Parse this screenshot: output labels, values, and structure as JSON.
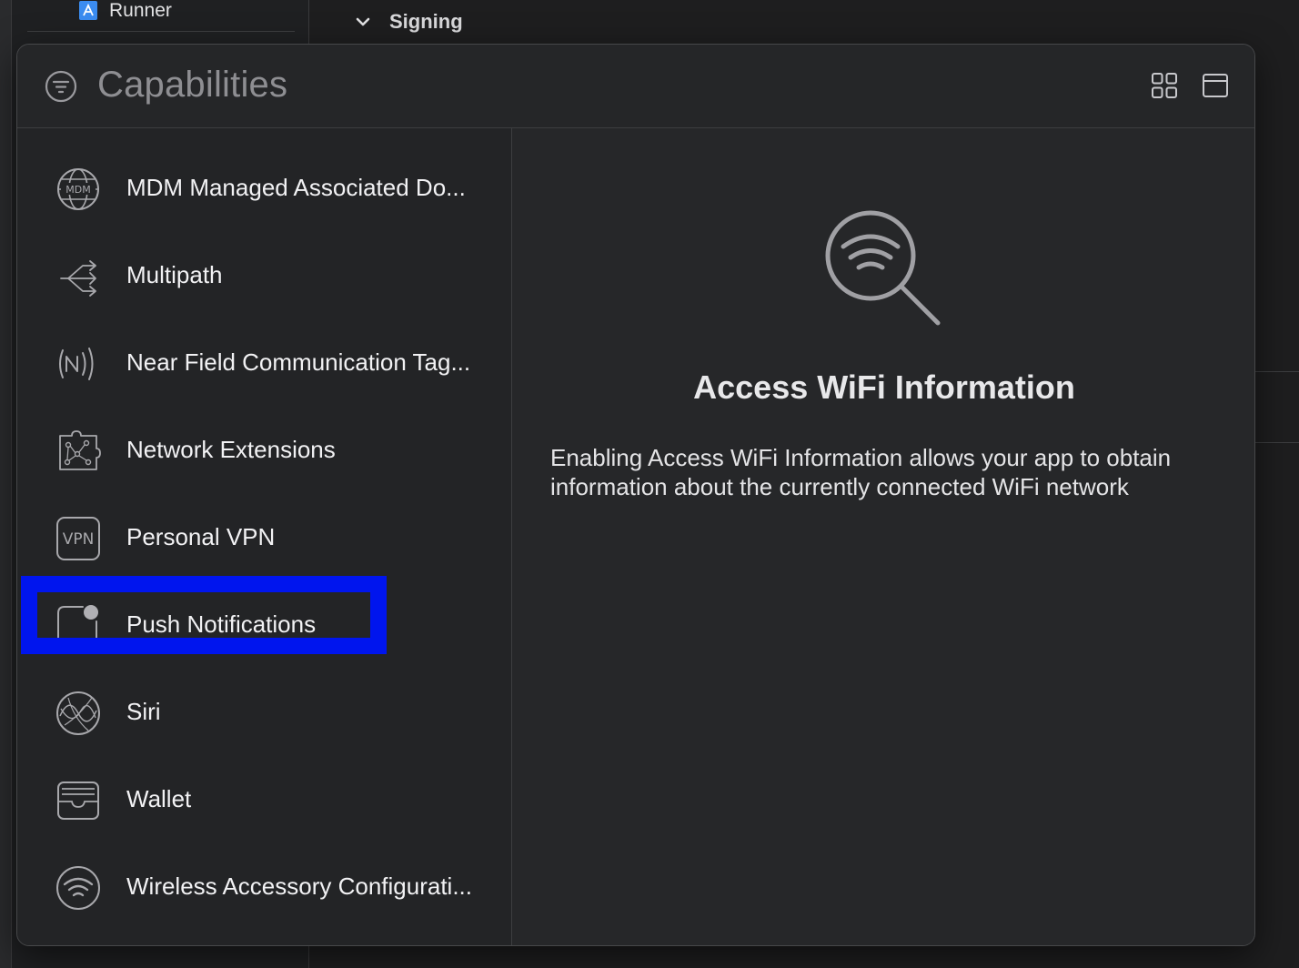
{
  "background": {
    "project_item": "Runner",
    "section_header": "Signing"
  },
  "popover": {
    "title": "Capabilities"
  },
  "capabilities": [
    {
      "label": "MDM Managed Associated Do...",
      "icon_text": "MDM"
    },
    {
      "label": "Multipath"
    },
    {
      "label": "Near Field Communication Tag..."
    },
    {
      "label": "Network Extensions"
    },
    {
      "label": "Personal VPN",
      "icon_text": "VPN"
    },
    {
      "label": "Push Notifications"
    },
    {
      "label": "Siri"
    },
    {
      "label": "Wallet"
    },
    {
      "label": "Wireless Accessory Configurati..."
    }
  ],
  "detail": {
    "title": "Access WiFi Information",
    "description": "Enabling Access WiFi Information allows your app to obtain information about the currently connected WiFi network"
  },
  "colors": {
    "highlight": "#0015ee",
    "panel": "#262729",
    "text": "#f2f2f4"
  }
}
